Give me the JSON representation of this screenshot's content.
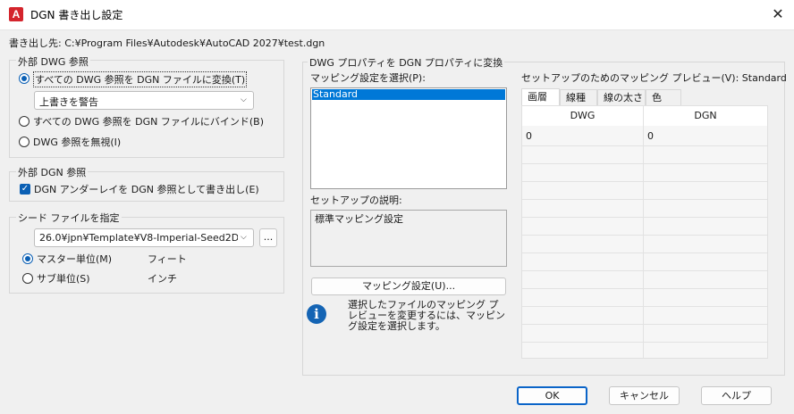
{
  "window": {
    "title": "DGN 書き出し設定",
    "app_icon_letter": "A",
    "close_glyph": "✕"
  },
  "destination": "書き出し先: C:¥Program Files¥Autodesk¥AutoCAD 2027¥test.dgn",
  "external_dwg": {
    "label": "外部 DWG 参照",
    "options": [
      {
        "label": "すべての DWG 参照を DGN ファイルに変換(T)",
        "selected": true
      },
      {
        "label": "すべての DWG 参照を DGN ファイルにバインド(B)",
        "selected": false
      },
      {
        "label": "DWG 参照を無視(I)",
        "selected": false
      }
    ],
    "overwrite_combo": "上書きを警告"
  },
  "external_dgn": {
    "label": "外部 DGN 参照",
    "checkbox_label": "DGN アンダーレイを DGN 参照として書き出し(E)",
    "checked": true
  },
  "seed": {
    "label": "シード ファイルを指定",
    "combo": "26.0¥jpn¥Template¥V8-Imperial-Seed2D.dgn",
    "browse_label": "...",
    "options": [
      {
        "label": "マスター単位(M)",
        "value": "フィート",
        "selected": true
      },
      {
        "label": "サブ単位(S)",
        "value": "インチ",
        "selected": false
      }
    ]
  },
  "props": {
    "label": "DWG プロパティを DGN プロパティに変換",
    "select_label": "マッピング設定を選択(P):",
    "list_items": [
      "Standard"
    ],
    "desc_label": "セットアップの説明:",
    "desc_value": "標準マッピング設定",
    "mapping_button": "マッピング設定(U)...",
    "info_glyph": "i",
    "info_text": "選択したファイルのマッピング プレビューを変更するには、マッピング設定を選択します。",
    "preview_label": "セットアップのためのマッピング プレビュー(V): Standard",
    "tabs": [
      "画層",
      "線種",
      "線の太さ",
      "色"
    ],
    "table": {
      "headers": [
        "DWG",
        "DGN"
      ],
      "rows": [
        [
          "0",
          "0"
        ]
      ]
    }
  },
  "buttons": {
    "ok": "OK",
    "cancel": "キャンセル",
    "help": "ヘルプ"
  },
  "colors": {
    "accent": "#0a5fb4",
    "selection": "#0078d7",
    "app_icon": "#d4242c"
  }
}
